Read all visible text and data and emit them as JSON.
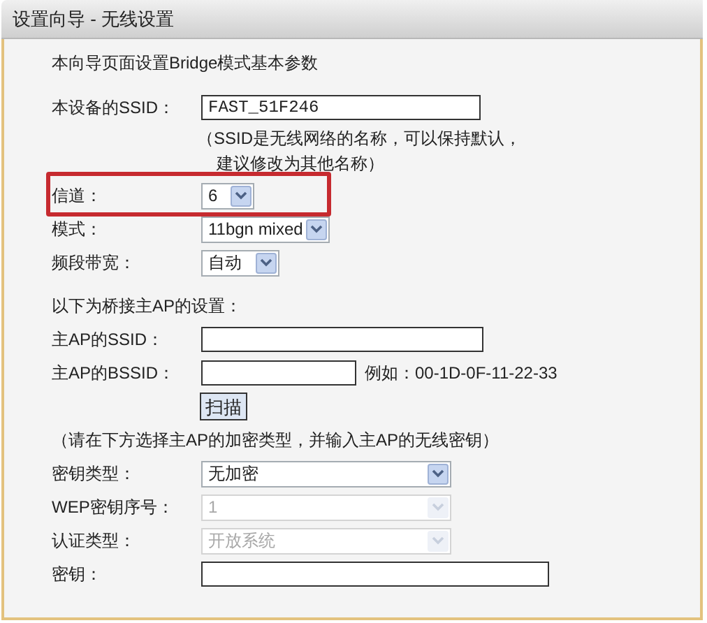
{
  "window": {
    "title": "设置向导 - 无线设置"
  },
  "items": [
    {
      "kind": "text",
      "text": "本向导页面设置Bridge模式基本参数"
    },
    {
      "kind": "field",
      "label": "本设备的SSID：",
      "value": "FAST_51F246",
      "highlighted": false
    },
    {
      "kind": "note",
      "lines": [
        "（SSID是无线网络的名称，可以保持默认，",
        "建议修改为其他名称）"
      ]
    },
    {
      "kind": "select",
      "label": "信道：",
      "value": "6",
      "disabled": false,
      "highlighted": true
    },
    {
      "kind": "select",
      "label": "模式：",
      "value": "11bgn mixed",
      "disabled": false,
      "highlighted": false
    },
    {
      "kind": "select",
      "label": "频段带宽：",
      "value": "自动",
      "disabled": false,
      "highlighted": false
    },
    {
      "kind": "text",
      "text": "以下为桥接主AP的设置："
    },
    {
      "kind": "field",
      "label": "主AP的SSID：",
      "highlighted": false
    },
    {
      "kind": "field",
      "label": "主AP的BSSID：",
      "hint": "例如：00-1D-0F-11-22-33",
      "highlighted": false
    },
    {
      "kind": "button",
      "label": "扫描"
    },
    {
      "kind": "text",
      "text": "（请在下方选择主AP的加密类型，并输入主AP的无线密钥）"
    },
    {
      "kind": "select",
      "label": "密钥类型：",
      "value": "无加密",
      "disabled": false,
      "highlighted": false
    },
    {
      "kind": "select",
      "label": "WEP密钥序号：",
      "value": "1",
      "disabled": true,
      "highlighted": false
    },
    {
      "kind": "select",
      "label": "认证类型：",
      "value": "开放系统",
      "disabled": true,
      "highlighted": false
    },
    {
      "kind": "field",
      "label": "密钥：",
      "highlighted": false
    }
  ]
}
